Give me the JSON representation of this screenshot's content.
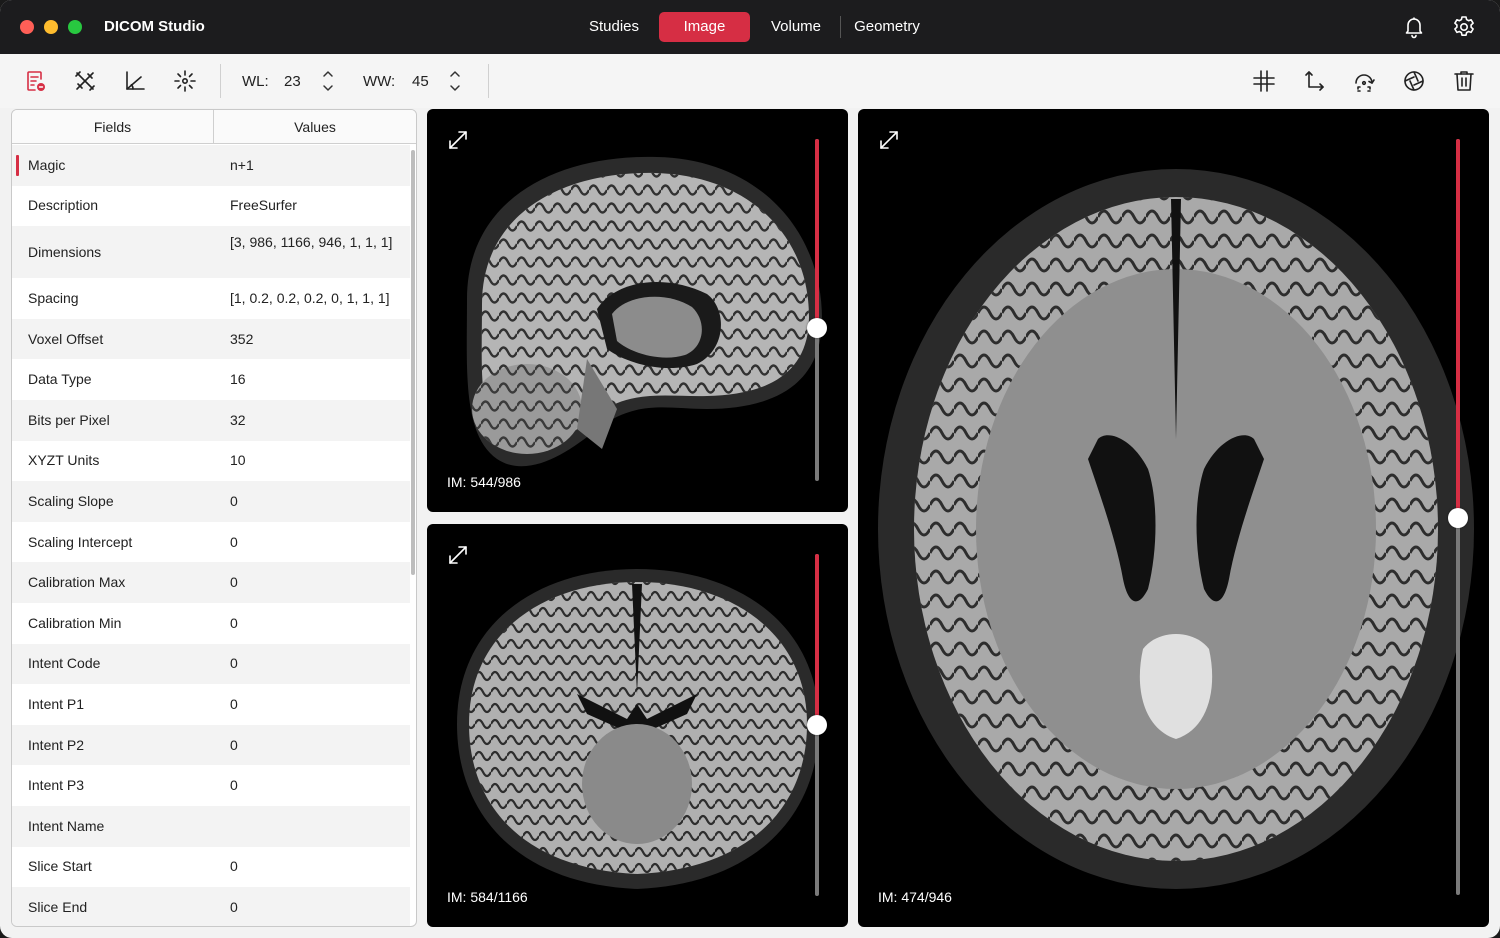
{
  "app": {
    "title": "DICOM Studio"
  },
  "nav": {
    "studies": "Studies",
    "image": "Image",
    "volume": "Volume",
    "geometry": "Geometry",
    "active": "Image"
  },
  "colors": {
    "accent": "#d62e44",
    "titlebar": "#1c1c1e"
  },
  "toolbar": {
    "left_icons": [
      "file-report-icon",
      "tools-crossed-icon",
      "angle-measure-icon",
      "crosshair-sun-icon"
    ],
    "wl_label": "WL:",
    "wl_value": "23",
    "ww_label": "WW:",
    "ww_value": "45",
    "right_icons": [
      "grid-hash-icon",
      "axis-arrows-icon",
      "rotate-reset-icon",
      "aperture-icon",
      "trash-icon"
    ]
  },
  "table": {
    "headers": {
      "fields": "Fields",
      "values": "Values"
    },
    "rows": [
      {
        "field": "Magic",
        "value": "n+1"
      },
      {
        "field": "Description",
        "value": "FreeSurfer"
      },
      {
        "field": "Dimensions",
        "value": "[3, 986, 1166, 946, 1, 1, 1]"
      },
      {
        "field": "Spacing",
        "value": "[1, 0.2, 0.2, 0.2, 0, 1, 1, 1]"
      },
      {
        "field": "Voxel Offset",
        "value": "352"
      },
      {
        "field": "Data Type",
        "value": "16"
      },
      {
        "field": "Bits per Pixel",
        "value": "32"
      },
      {
        "field": "XYZT Units",
        "value": "10"
      },
      {
        "field": "Scaling Slope",
        "value": "0"
      },
      {
        "field": "Scaling Intercept",
        "value": "0"
      },
      {
        "field": "Calibration Max",
        "value": "0"
      },
      {
        "field": "Calibration Min",
        "value": "0"
      },
      {
        "field": "Intent Code",
        "value": "0"
      },
      {
        "field": "Intent P1",
        "value": "0"
      },
      {
        "field": "Intent P2",
        "value": "0"
      },
      {
        "field": "Intent P3",
        "value": "0"
      },
      {
        "field": "Intent Name",
        "value": ""
      },
      {
        "field": "Slice Start",
        "value": "0"
      },
      {
        "field": "Slice End",
        "value": "0"
      }
    ]
  },
  "viewports": {
    "sagittal": {
      "label": "IM: 544/986",
      "slice": 544,
      "total": 986
    },
    "coronal": {
      "label": "IM: 584/1166",
      "slice": 584,
      "total": 1166
    },
    "axial": {
      "label": "IM: 474/946",
      "slice": 474,
      "total": 946
    }
  }
}
